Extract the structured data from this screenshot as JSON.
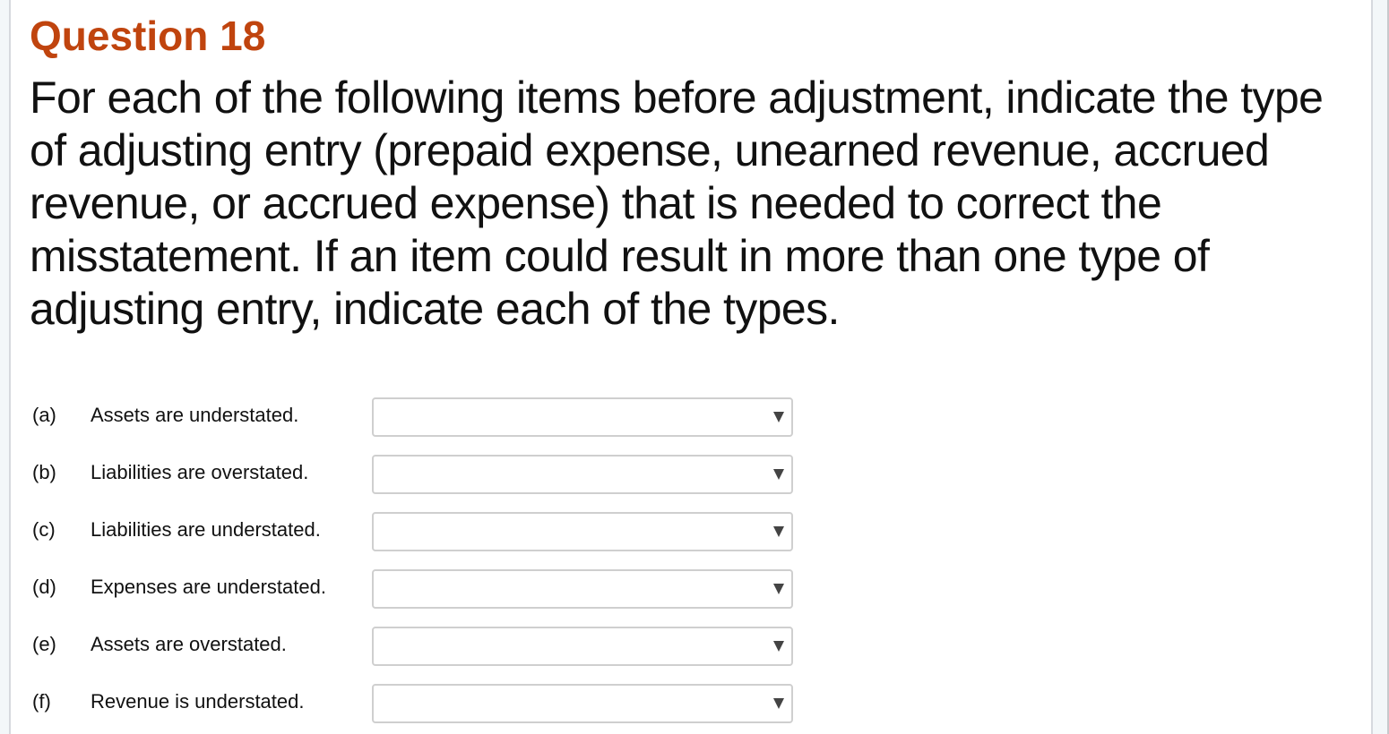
{
  "question": {
    "title": "Question 18",
    "text": "For each of the following items before adjustment, indicate the type of adjusting entry (prepaid expense, unearned revenue, accrued revenue, or accrued expense) that is needed to correct the misstatement. If an item could result in more than one type of adjusting entry, indicate each of the types."
  },
  "items": [
    {
      "letter": "(a)",
      "text": "Assets are understated.",
      "selected": "",
      "icon": "chevron-down-icon"
    },
    {
      "letter": "(b)",
      "text": "Liabilities are overstated.",
      "selected": "",
      "icon": "chevron-down-icon"
    },
    {
      "letter": "(c)",
      "text": "Liabilities are understated.",
      "selected": "",
      "icon": "chevron-down-icon"
    },
    {
      "letter": "(d)",
      "text": "Expenses are understated.",
      "selected": "",
      "icon": "chevron-down-icon"
    },
    {
      "letter": "(e)",
      "text": "Assets are overstated.",
      "selected": "",
      "icon": "chevron-down-icon"
    },
    {
      "letter": "(f)",
      "text": "Revenue is understated.",
      "selected": "",
      "icon": "chevron-down-icon"
    }
  ],
  "colors": {
    "title": "#c0440e",
    "text": "#111111",
    "select_border": "#cfcfcf",
    "caret": "#444444",
    "gutter": "#f3f7f9"
  }
}
